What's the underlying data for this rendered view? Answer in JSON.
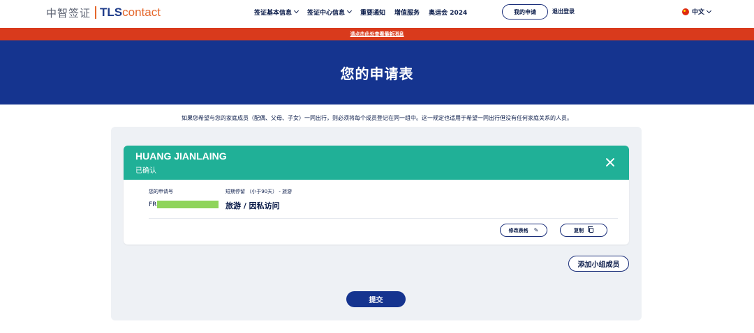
{
  "header": {
    "logo_cn": "中智签证",
    "logo_tls": "TLS",
    "logo_contact": "contact",
    "nav": [
      {
        "label": "签证基本信息",
        "has_dropdown": true
      },
      {
        "label": "签证中心信息",
        "has_dropdown": true
      },
      {
        "label": "重要通知",
        "has_dropdown": false
      },
      {
        "label": "增值服务",
        "has_dropdown": false
      },
      {
        "label": "奥运会 2024",
        "has_dropdown": false
      }
    ],
    "my_application": "我的申请",
    "logout": "退出登录",
    "language": "中文",
    "language_icon": "china-flag-icon"
  },
  "notice_banner": "请点击此处查看最新消息",
  "hero": {
    "title": "您的申请表"
  },
  "intro_text": "如果您希望与您的家庭成员（配偶、父母、子女）一同出行，则必须将每个成员登记在同一组中。这一规定也适用于希望一同出行但没有任何家庭关系的人员。",
  "applicant": {
    "name": "HUANG JIANLAING",
    "status": "已确认",
    "app_no_label": "您的申请号",
    "app_no_prefix": "FR",
    "visa_type": "短期停留 （小于90天） - 旅游",
    "purpose": "旅游 / 因私访问",
    "edit_label": "修改表格",
    "copy_label": "复制"
  },
  "actions": {
    "add_member": "添加小组成员",
    "submit": "提交"
  },
  "colors": {
    "primary": "#15348f",
    "banner": "#d93a1c",
    "card_header": "#20b097",
    "panel_bg": "#eef1f5"
  }
}
